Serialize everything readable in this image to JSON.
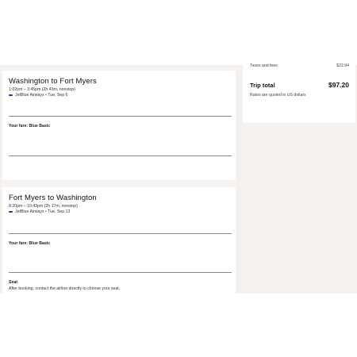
{
  "flights": [
    {
      "title": "Washington to Fort Myers",
      "time": "1:02pm – 3:45pm (2h 43m, nonstop)",
      "airline": "JetBlue Airways • Tue, Sep 6",
      "fare": "Your fare: Blue Basic"
    },
    {
      "title": "Fort Myers to Washington",
      "time": "8:20pm – 10:43pm (2h 17m, nonstop)",
      "airline": "JetBlue Airways • Tue, Sep 13",
      "fare": "Your fare: Blue Basic",
      "seat_label": "Seat",
      "seat_text": "After booking, contact the airline directly to choose your seat."
    }
  ],
  "summary": {
    "taxes_label": "Taxes and fees",
    "taxes_value": "$22.94",
    "total_label": "Trip total",
    "total_value": "$97.20",
    "note": "Rates are quoted in US dollars"
  },
  "colors": {
    "page_background": "#f5f1ef",
    "card": "#ffffff",
    "airline_logo": "#2a3a8a"
  }
}
